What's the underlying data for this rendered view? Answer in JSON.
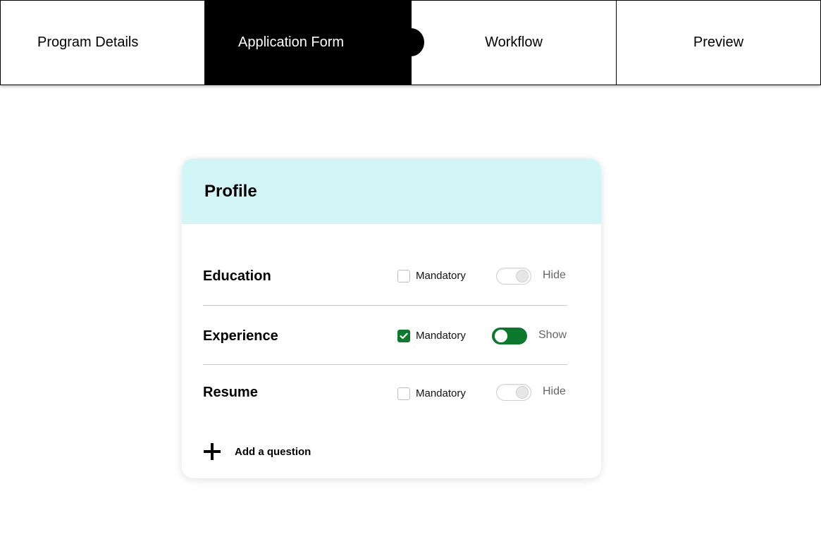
{
  "stepper": {
    "steps": [
      {
        "label": "Program Details"
      },
      {
        "label": "Application Form"
      },
      {
        "label": "Workflow"
      },
      {
        "label": "Preview"
      }
    ],
    "active_step": "Application Form"
  },
  "card": {
    "title": "Profile",
    "header_color": "#d2f6f8",
    "rows": [
      {
        "label": "Education",
        "mandatory_label": "Mandatory",
        "mandatory": false,
        "toggle_on": false,
        "toggle_state": "Hide"
      },
      {
        "label": "Experience",
        "mandatory_label": "Mandatory",
        "mandatory": true,
        "toggle_on": true,
        "toggle_state": "Show"
      },
      {
        "label": "Resume",
        "mandatory_label": "Mandatory",
        "mandatory": false,
        "toggle_on": false,
        "toggle_state": "Hide"
      }
    ],
    "add_question_label": "Add a question",
    "accent_color": "#0b7a2c"
  }
}
